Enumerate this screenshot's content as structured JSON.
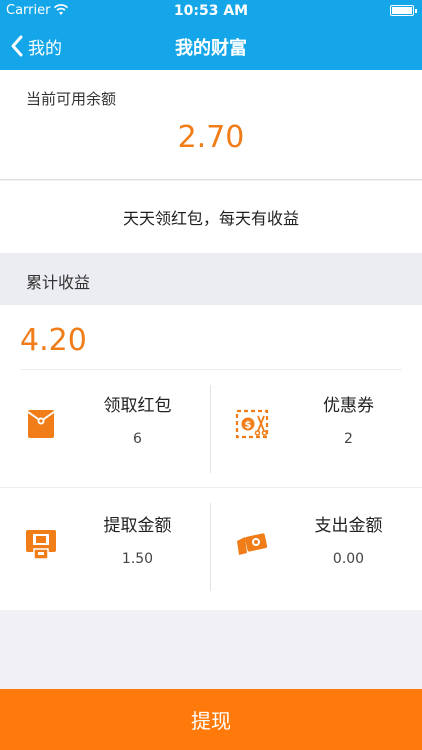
{
  "status_bar": {
    "carrier": "Carrier",
    "time": "10:53 AM"
  },
  "nav": {
    "back_label": "我的",
    "title": "我的财富"
  },
  "balance": {
    "label": "当前可用余额",
    "amount": "2.70"
  },
  "promo_text": "天天领红包，每天有收益",
  "cumulative": {
    "header": "累计收益",
    "total": "4.20",
    "items": [
      {
        "label": "领取红包",
        "value": "6",
        "icon": "red-envelope-icon"
      },
      {
        "label": "优惠券",
        "value": "2",
        "icon": "coupon-icon"
      },
      {
        "label": "提取金额",
        "value": "1.50",
        "icon": "atm-withdraw-icon"
      },
      {
        "label": "支出金额",
        "value": "0.00",
        "icon": "payment-card-icon"
      }
    ]
  },
  "withdraw_button": "提现",
  "colors": {
    "nav": "#14a6e8",
    "accent": "#f07d18",
    "button": "#ff7a0a"
  }
}
